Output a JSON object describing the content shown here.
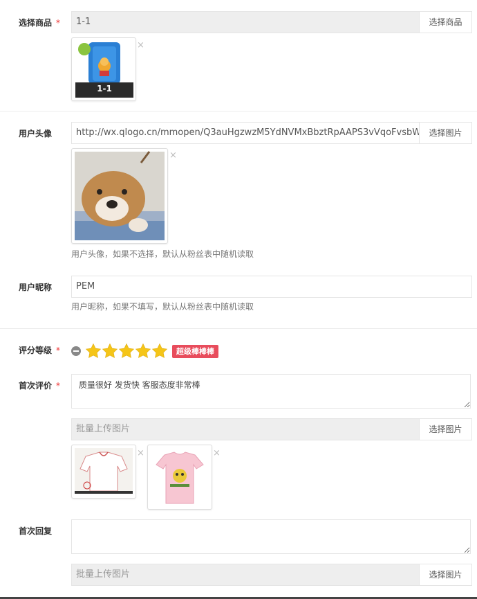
{
  "product": {
    "label": "选择商品",
    "required_mark": "*",
    "value": "1-1",
    "button": "选择商品",
    "thumb_caption": "1-1",
    "close": "×"
  },
  "avatar": {
    "label": "用户头像",
    "value": "http://wx.qlogo.cn/mmopen/Q3auHgzwzM5YdNVMxBbztRpAAPS3vVqoFvsbW",
    "button": "选择图片",
    "help": "用户头像，如果不选择，默认从粉丝表中随机读取",
    "close": "×"
  },
  "nickname": {
    "label": "用户昵称",
    "value": "PEM",
    "help": "用户昵称，如果不填写，默认从粉丝表中随机读取"
  },
  "rating": {
    "label": "评分等级",
    "required_mark": "*",
    "stars": 5,
    "max_stars": 5,
    "badge": "超级棒棒棒",
    "star_color": "#f5c518",
    "badge_color": "#e84c5c"
  },
  "first_review": {
    "label": "首次评价",
    "required_mark": "*",
    "text": "质量很好 发货快 客服态度非常棒",
    "upload_placeholder": "批量上传图片",
    "button": "选择图片",
    "close": "×"
  },
  "first_reply": {
    "label": "首次回复",
    "text": "",
    "upload_placeholder": "批量上传图片",
    "button": "选择图片"
  }
}
